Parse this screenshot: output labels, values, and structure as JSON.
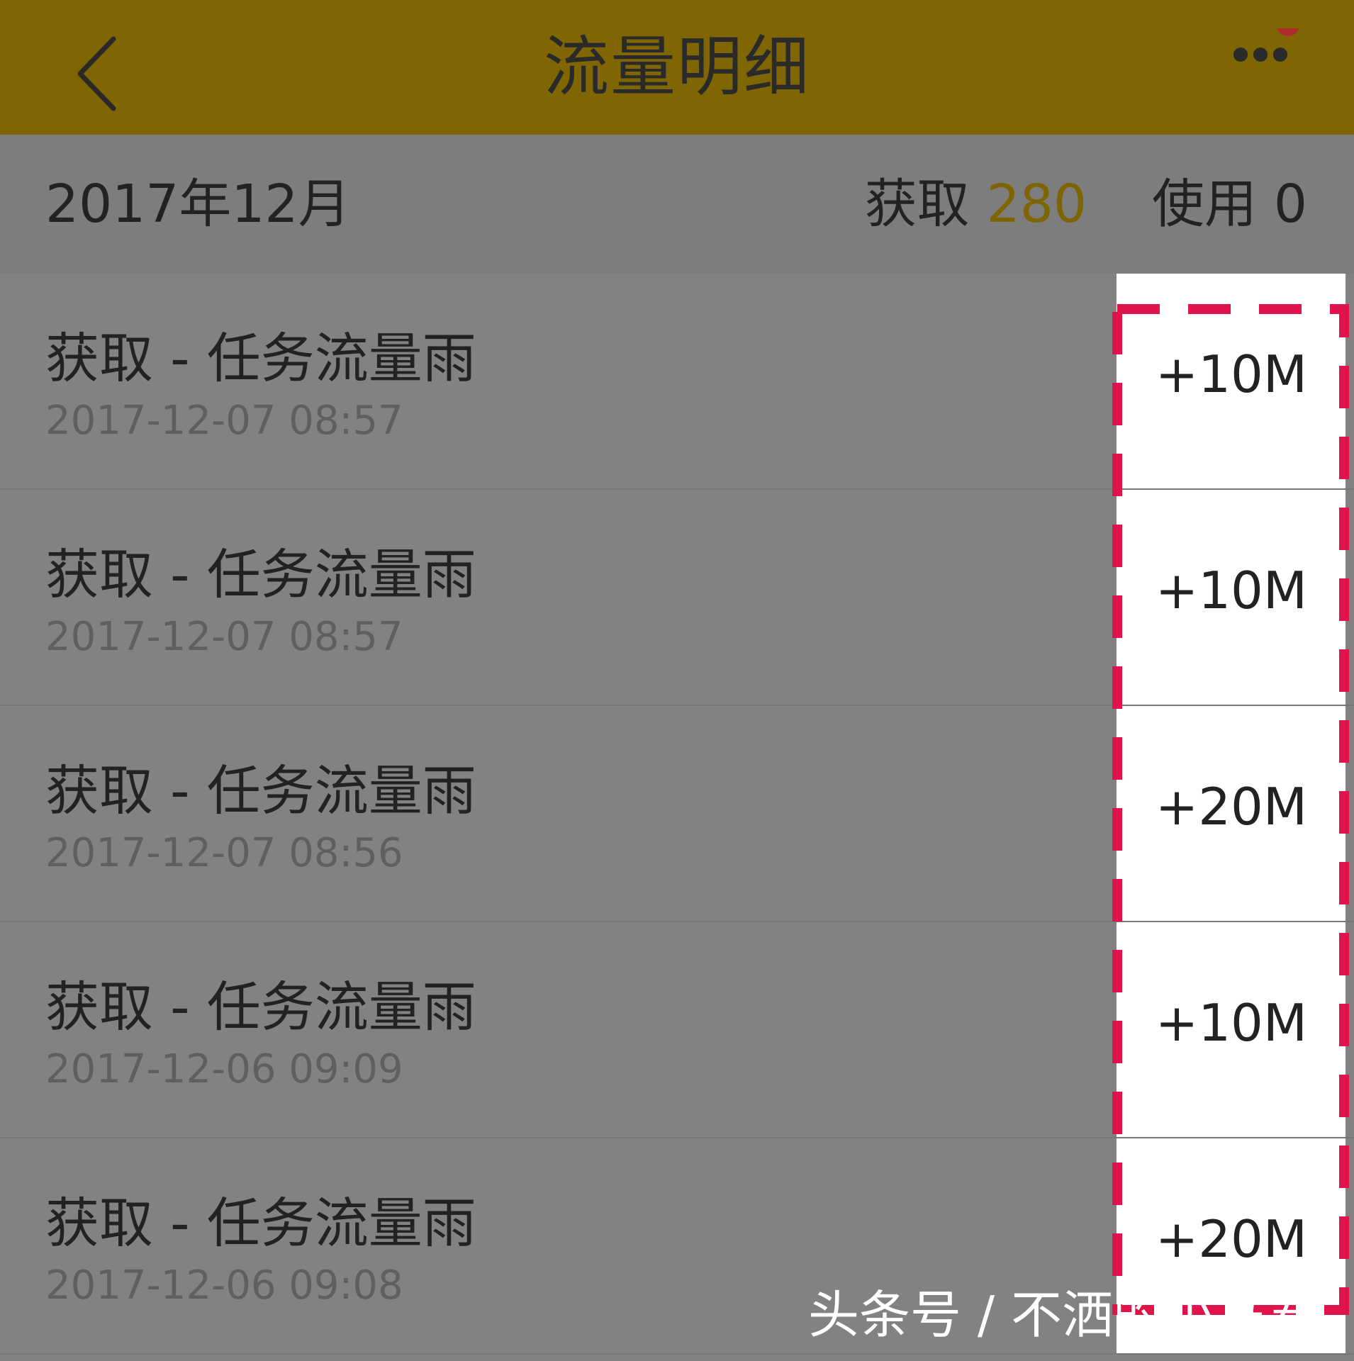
{
  "header": {
    "title": "流量明细"
  },
  "summary": {
    "month": "2017年12月",
    "gain_label": "获取",
    "gain_value": "280",
    "used_label": "使用",
    "used_value": "0"
  },
  "records": [
    {
      "title": "获取 - 任务流量雨",
      "time": "2017-12-07 08:57",
      "amount": "+10M"
    },
    {
      "title": "获取 - 任务流量雨",
      "time": "2017-12-07 08:57",
      "amount": "+10M"
    },
    {
      "title": "获取 - 任务流量雨",
      "time": "2017-12-07 08:56",
      "amount": "+20M"
    },
    {
      "title": "获取 - 任务流量雨",
      "time": "2017-12-06 09:09",
      "amount": "+10M"
    },
    {
      "title": "获取 - 任务流量雨",
      "time": "2017-12-06 09:08",
      "amount": "+20M"
    }
  ],
  "watermark": "头条号 / 不洒的小马君",
  "colors": {
    "header_bg": "#7f6602",
    "gain_accent": "#7d6503",
    "highlight_dash": "#e0134a",
    "notification_dot": "#b02b2b"
  },
  "icons": {
    "back": "chevron-left-icon",
    "more": "more-dots-icon",
    "badge": "notification-dot-icon"
  }
}
